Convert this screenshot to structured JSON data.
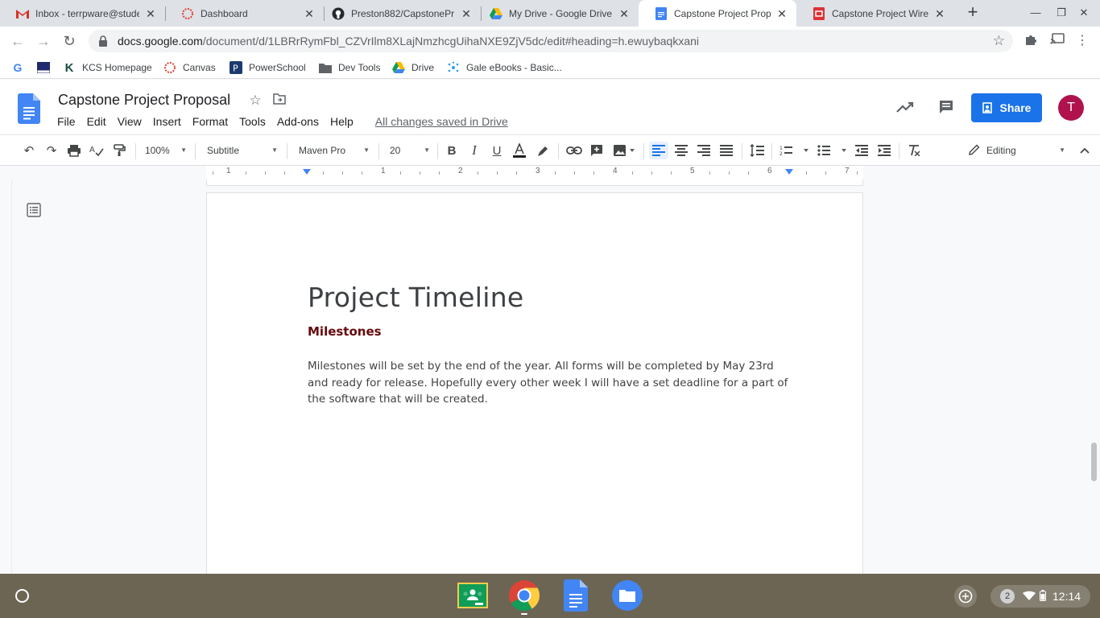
{
  "browser": {
    "tabs": [
      {
        "title": "Inbox - terrpware@stude",
        "icon": "gmail-icon"
      },
      {
        "title": "Dashboard",
        "icon": "canvas-icon"
      },
      {
        "title": "Preston882/CapstonePr",
        "icon": "github-icon"
      },
      {
        "title": "My Drive - Google Drive",
        "icon": "drive-icon"
      },
      {
        "title": "Capstone Project Propo",
        "icon": "docs-icon",
        "active": true
      },
      {
        "title": "Capstone Project WireFr",
        "icon": "slides-icon"
      }
    ],
    "url_host": "docs.google.com",
    "url_path": "/document/d/1LBRrRymFbl_CZVrIlm8XLajNmzhcgUihaNXE9ZjV5dc/edit#heading=h.ewuybaqkxani",
    "bookmarks": [
      {
        "label": "",
        "icon": "google-icon"
      },
      {
        "label": "",
        "icon": "flag-bookmark-icon"
      },
      {
        "label": "KCS Homepage",
        "icon": "kcs-icon"
      },
      {
        "label": "Canvas",
        "icon": "canvas-icon"
      },
      {
        "label": "PowerSchool",
        "icon": "powerschool-icon"
      },
      {
        "label": "Dev Tools",
        "icon": "folder-icon"
      },
      {
        "label": "Drive",
        "icon": "drive-icon"
      },
      {
        "label": "Gale eBooks - Basic...",
        "icon": "gale-icon"
      }
    ]
  },
  "docs": {
    "title": "Capstone Project Proposal",
    "menu": [
      "File",
      "Edit",
      "View",
      "Insert",
      "Format",
      "Tools",
      "Add-ons",
      "Help"
    ],
    "save_status": "All changes saved in Drive",
    "share_label": "Share",
    "avatar_initial": "T",
    "toolbar": {
      "zoom": "100%",
      "style": "Subtitle",
      "font": "Maven Pro",
      "font_size": "20",
      "mode": "Editing"
    },
    "ruler_numbers": [
      "1",
      "1",
      "2",
      "3",
      "4",
      "5",
      "6",
      "7"
    ]
  },
  "document": {
    "heading": "Project Timeline",
    "subheading": "Milestones",
    "paragraph": "Milestones will be set by the end of the year. All forms will be completed by May 23rd and ready for release. Hopefully every other week I will have a set deadline for a part of the software that will be created."
  },
  "shelf": {
    "notification_count": "2",
    "time": "12:14"
  },
  "colors": {
    "accent": "#1a73e8",
    "subtitle": "#66090b",
    "avatar": "#b0124e",
    "shelf": "#6c6554"
  }
}
